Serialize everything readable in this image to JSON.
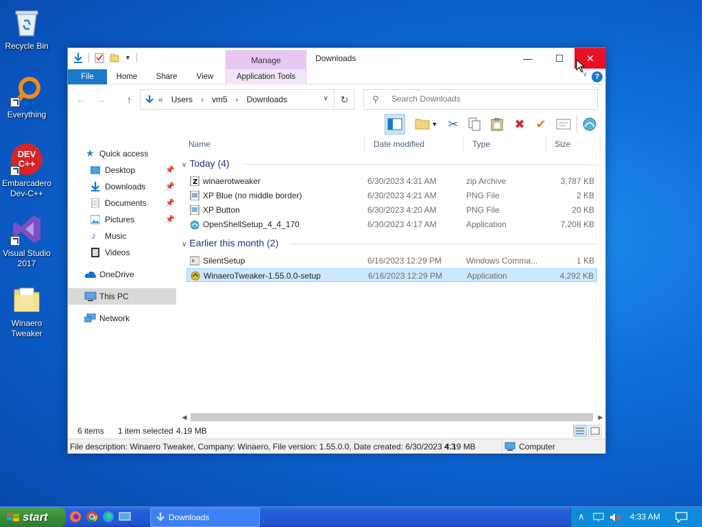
{
  "desktop": {
    "icons": [
      {
        "label": "Recycle Bin"
      },
      {
        "label": "Everything"
      },
      {
        "label": "Embarcadero Dev-C++"
      },
      {
        "label": "Visual Studio 2017"
      },
      {
        "label": "Winaero Tweaker"
      }
    ],
    "devcpp_icon_text": "DEV C++"
  },
  "window": {
    "title": "Downloads",
    "manage_tab": "Manage",
    "buttons": {
      "minimize": "—",
      "maximize": "☐",
      "close": "✕"
    }
  },
  "ribbon": {
    "tabs": [
      "File",
      "Home",
      "Share",
      "View",
      "Application Tools"
    ],
    "help": "?"
  },
  "address": {
    "prefix": "«",
    "crumbs": [
      "Users",
      "vm5",
      "Downloads"
    ],
    "separator": "›"
  },
  "search": {
    "placeholder": "Search Downloads"
  },
  "nav": {
    "quick_access": "Quick access",
    "items": [
      "Desktop",
      "Downloads",
      "Documents",
      "Pictures",
      "Music",
      "Videos"
    ],
    "onedrive": "OneDrive",
    "this_pc": "This PC",
    "network": "Network"
  },
  "columns": {
    "name": "Name",
    "date": "Date modified",
    "type": "Type",
    "size": "Size"
  },
  "groups": [
    {
      "title": "Today (4)",
      "files": [
        {
          "name": "winaerotweaker",
          "date": "6/30/2023 4:31 AM",
          "type": "zip Archive",
          "size": "3,787 KB",
          "icon": "zip-icon"
        },
        {
          "name": "XP Blue (no middle border)",
          "date": "6/30/2023 4:21 AM",
          "type": "PNG File",
          "size": "2 KB",
          "icon": "png-icon"
        },
        {
          "name": "XP Button",
          "date": "6/30/2023 4:20 AM",
          "type": "PNG File",
          "size": "20 KB",
          "icon": "png-icon"
        },
        {
          "name": "OpenShellSetup_4_4_170",
          "date": "6/30/2023 4:17 AM",
          "type": "Application",
          "size": "7,208 KB",
          "icon": "openshell-icon"
        }
      ]
    },
    {
      "title": "Earlier this month (2)",
      "files": [
        {
          "name": "SilentSetup",
          "date": "6/16/2023 12:29 PM",
          "type": "Windows Comma...",
          "size": "1 KB",
          "icon": "cmd-icon"
        },
        {
          "name": "WinaeroTweaker-1.55.0.0-setup",
          "date": "6/16/2023 12:29 PM",
          "type": "Application",
          "size": "4,292 KB",
          "icon": "installer-icon"
        }
      ]
    }
  ],
  "status": {
    "items": "6 items",
    "selected": "1 item selected",
    "size": "4.19 MB"
  },
  "info": {
    "description": "File description: Winaero Tweaker, Company: Winaero, File version: 1.55.0.0, Date created: 6/30/2023 4:3",
    "size": "4.19 MB",
    "location": "Computer"
  },
  "taskbar": {
    "start": "start",
    "task": "Downloads",
    "clock": "4:33 AM"
  },
  "colors": {
    "accent": "#1979ca",
    "close": "#e81123",
    "manage": "#e8c8f3",
    "selection": "#cce8ff",
    "group_header": "#1e3287"
  }
}
